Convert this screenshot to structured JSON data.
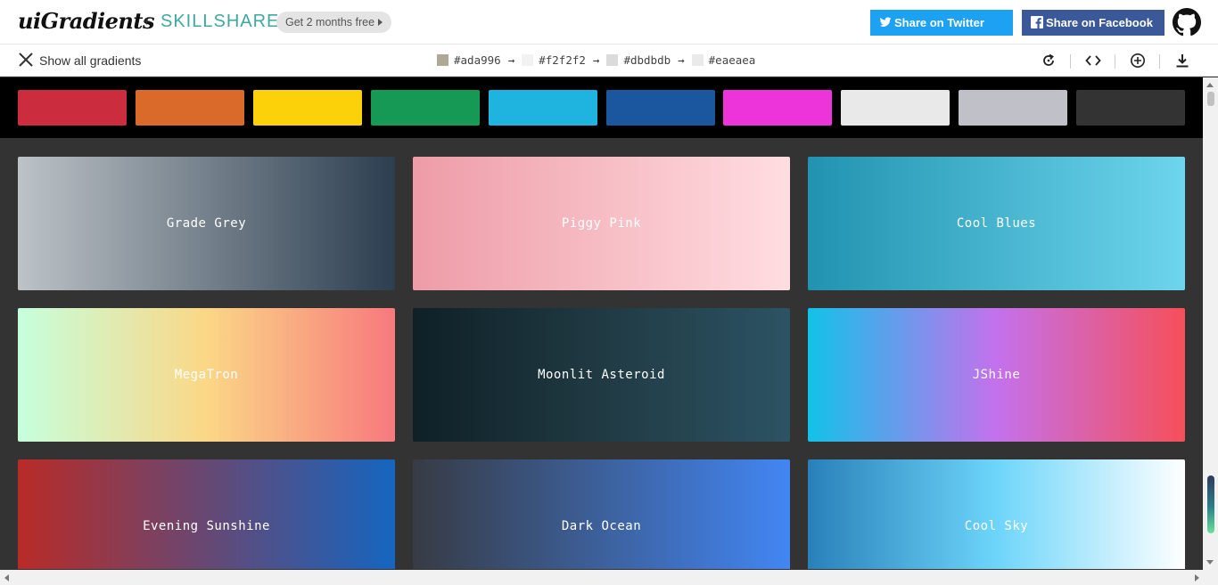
{
  "header": {
    "logo": "uiGradients",
    "plus": "+",
    "partner": "SKILLSHARE",
    "promo": "Get 2 months free",
    "share_twitter": "Share on Twitter",
    "share_facebook": "Share on Facebook",
    "icons": [
      "twitter-icon",
      "facebook-icon",
      "github-icon"
    ]
  },
  "toolbar": {
    "show_all": "Show all gradients",
    "current_colors": [
      {
        "hex": "#ada996",
        "label": "#ada996"
      },
      {
        "hex": "#f2f2f2",
        "label": "#f2f2f2"
      },
      {
        "hex": "#dbdbdb",
        "label": "#dbdbdb"
      },
      {
        "hex": "#eaeaea",
        "label": "#eaeaea"
      }
    ],
    "arrow": "→",
    "tools": [
      "rotate-icon",
      "code-icon",
      "add-icon",
      "download-icon"
    ]
  },
  "color_filters": [
    "#cb2d3e",
    "#da6a2a",
    "#fdd10a",
    "#169955",
    "#1fb3e0",
    "#1a579e",
    "#ed33da",
    "#e9e9e9",
    "#c0c0c8",
    "#333333"
  ],
  "gradients": [
    {
      "name": "Grade Grey",
      "colors": [
        "#bdc3c7",
        "#2c3e50"
      ]
    },
    {
      "name": "Piggy Pink",
      "colors": [
        "#ee9ca7",
        "#ffdde1"
      ]
    },
    {
      "name": "Cool Blues",
      "colors": [
        "#2193b0",
        "#6dd5ed"
      ]
    },
    {
      "name": "MegaTron",
      "colors": [
        "#c6ffdd",
        "#fbd786",
        "#f7797d"
      ]
    },
    {
      "name": "Moonlit Asteroid",
      "colors": [
        "#0f2027",
        "#203a43",
        "#2c5364"
      ]
    },
    {
      "name": "JShine",
      "colors": [
        "#12c2e9",
        "#c471ed",
        "#f64f59"
      ]
    },
    {
      "name": "Evening Sunshine",
      "colors": [
        "#b92b27",
        "#1565c0"
      ]
    },
    {
      "name": "Dark Ocean",
      "colors": [
        "#373b44",
        "#4286f4"
      ]
    },
    {
      "name": "Cool Sky",
      "colors": [
        "#2980b9",
        "#6dd5fa",
        "#ffffff"
      ]
    }
  ]
}
